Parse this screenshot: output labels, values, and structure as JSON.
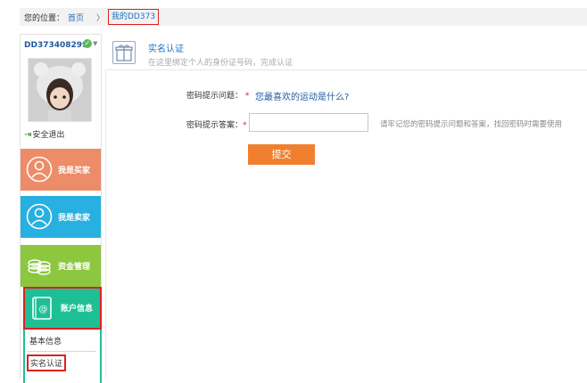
{
  "breadcrumb": {
    "prefix": "您的位置：",
    "home": "首页",
    "separator": "〉",
    "current": "我的DD373"
  },
  "sidebar": {
    "username": "DD373408299",
    "verified_icon": "check-circle-icon",
    "logout_label": "安全退出",
    "tiles": [
      {
        "label": "我是买家",
        "icon": "user-circle-icon",
        "color": "#ec8c68"
      },
      {
        "label": "我是卖家",
        "icon": "user-circle-icon",
        "color": "#27b0e0"
      },
      {
        "label": "资金管理",
        "icon": "coins-icon",
        "color": "#8dc63f"
      },
      {
        "label": "账户信息",
        "icon": "contact-book-icon",
        "color": "#1fbf96"
      }
    ],
    "submenu": [
      {
        "label": "基本信息"
      },
      {
        "label": "实名认证"
      }
    ]
  },
  "content": {
    "title": "实名认证",
    "subtitle": "在这里绑定个人的身份证号码，完成认证",
    "question_label": "密码提示问题：",
    "question_value": "您最喜欢的运动是什么?",
    "answer_label": "密码提示答案：",
    "required_mark": "*",
    "answer_value": "",
    "hint": "请牢记您的密码提示问题和答案，找回密码时需要使用",
    "submit_label": "提交"
  },
  "colors": {
    "accent_orange": "#f08030",
    "link_blue": "#1f6fbe",
    "highlight_red": "#e02020"
  }
}
